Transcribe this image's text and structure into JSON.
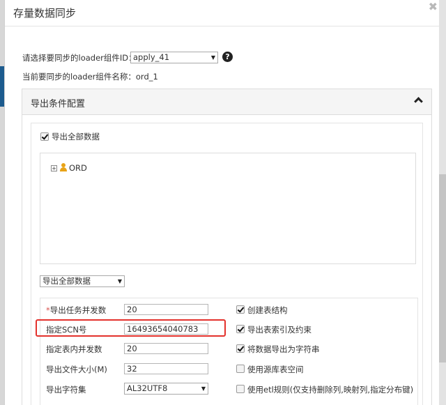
{
  "dialog": {
    "title": "存量数据同步",
    "close_symbol": "✖"
  },
  "loader": {
    "select_label": "请选择要同步的loader组件ID：",
    "select_value": "apply_41",
    "current_name_label": "当前要同步的loader组件名称：ord_1",
    "help_symbol": "?"
  },
  "panel": {
    "title": "导出条件配置",
    "export_all_label": "导出全部数据",
    "tree": {
      "node_label": "ORD",
      "expand_symbol": "+"
    },
    "export_mode_value": "导出全部数据"
  },
  "config": {
    "left": [
      {
        "required": "*",
        "label": "导出任务并发数",
        "value": "20",
        "type": "input"
      },
      {
        "required": "",
        "label": "指定SCN号",
        "value": "16493654040783",
        "type": "input"
      },
      {
        "required": "",
        "label": "指定表内并发数",
        "value": "20",
        "type": "input"
      },
      {
        "required": "",
        "label": "导出文件大小(M)",
        "value": "32",
        "type": "input"
      },
      {
        "required": "",
        "label": "导出字符集",
        "value": "AL32UTF8",
        "type": "select"
      }
    ],
    "right": [
      {
        "label": "创建表结构",
        "checked": true
      },
      {
        "label": "导出表索引及约束",
        "checked": true
      },
      {
        "label": "将数据导出为字符串",
        "checked": true
      },
      {
        "label": "使用源库表空间",
        "checked": false
      },
      {
        "label": "使用etl规则(仅支持删除列,映射列,指定分布键)",
        "checked": false
      }
    ]
  },
  "colors": {
    "highlight": "#e3312c",
    "user_icon": "#e8a317"
  }
}
